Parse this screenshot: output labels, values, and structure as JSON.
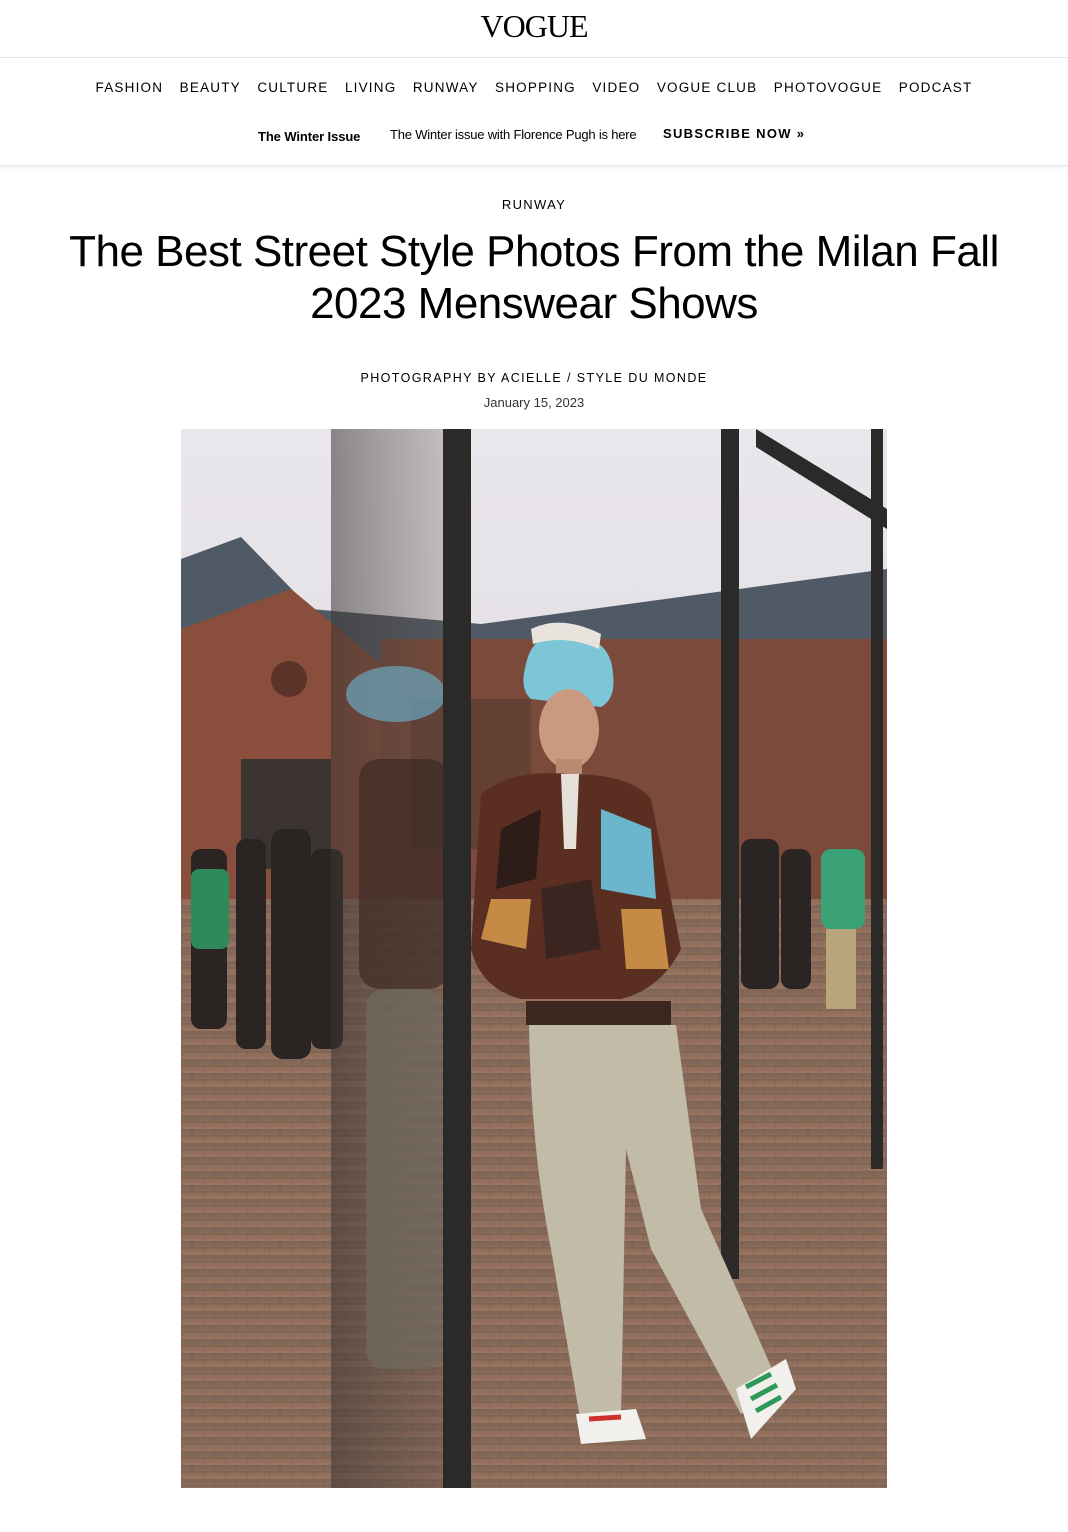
{
  "site": {
    "logo_text": "VOGUE"
  },
  "nav": {
    "items": [
      "FASHION",
      "BEAUTY",
      "CULTURE",
      "LIVING",
      "RUNWAY",
      "SHOPPING",
      "VIDEO",
      "VOGUE CLUB",
      "PHOTOVOGUE",
      "PODCAST"
    ]
  },
  "promo": {
    "issue_label": "The Winter Issue",
    "text": "The Winter issue with Florence Pugh is here",
    "cta": "SUBSCRIBE NOW »"
  },
  "article": {
    "rubric": "RUNWAY",
    "headline": "The Best Street Style Photos From the Milan Fall 2023 Menswear Shows",
    "byline": "PHOTOGRAPHY BY ACIELLE / STYLE DU MONDE",
    "date": "January 15, 2023"
  },
  "colors": {
    "sky": "#e6e3ea",
    "brick": "#8a4e3c",
    "glass_frame": "#2b2a28",
    "cobblestone": "#8a6a55",
    "cap": "#7cc6d8",
    "jacket_brown": "#5a2f22",
    "pants": "#c2bba7",
    "shoe_stripe": "#2e9a5a"
  },
  "icons": {
    "photo": "street-style-photo"
  }
}
